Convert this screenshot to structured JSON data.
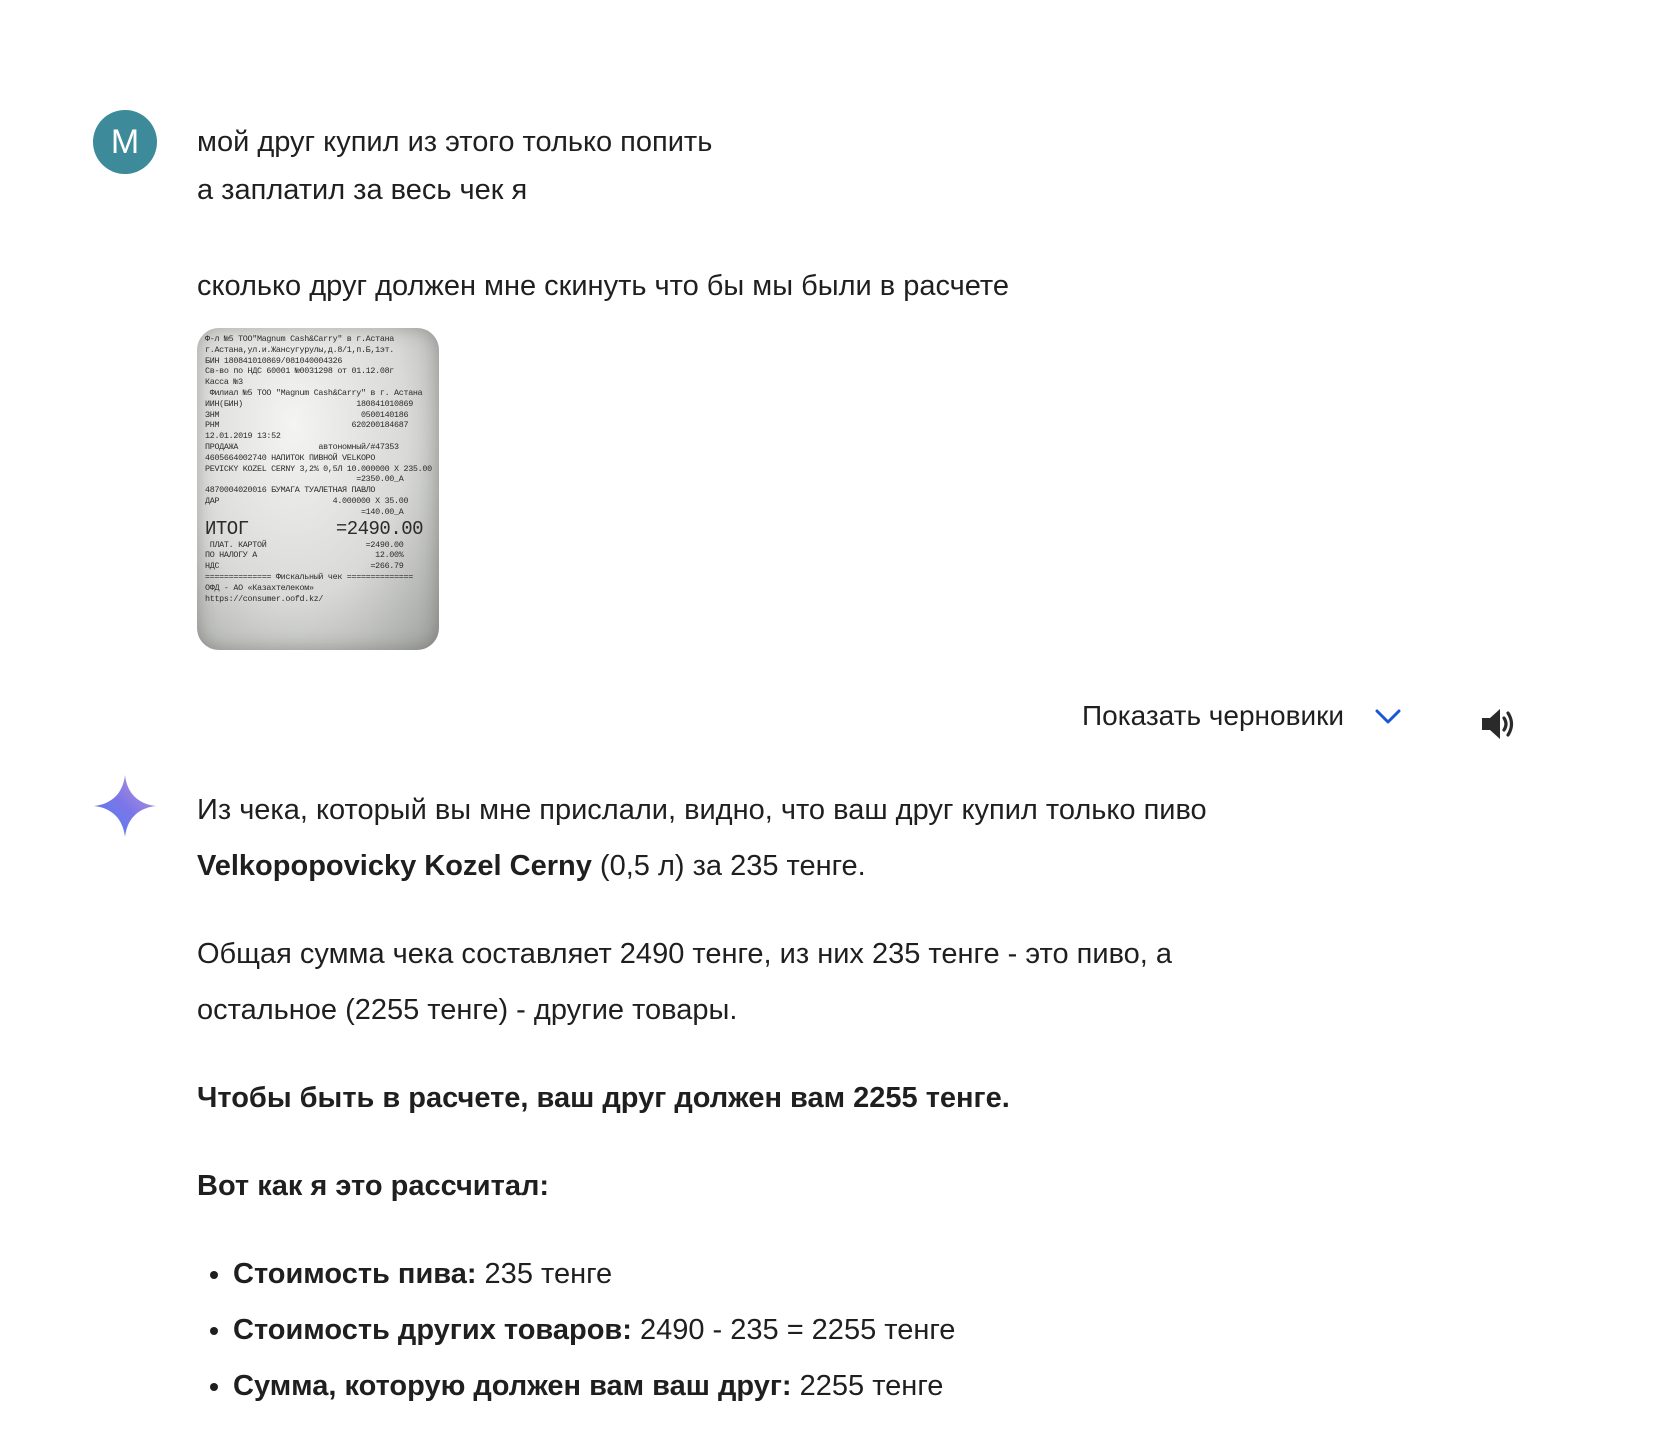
{
  "user": {
    "avatar_letter": "M",
    "lines": [
      "мой друг купил из этого только попить",
      "а заплатил за весь чек я",
      "сколько друг должен мне скинуть что бы мы были в расчете"
    ],
    "receipt_text": "Ф-л №5 ТОО\"Magnum Cash&Carry\" в г.Астана\nг.Астана,ул.и.Жансугурулы,д.8/1,п.Б,1эт.\nБИН 180841010869/081040004326\nСв-во по НДС 60001 №0031298 от 01.12.08г\nКасса №3\n Филиал №5 ТОО \"Magnum Cash&Carry\" в г. Астана\nИИН(БИН)                        180841010869\nЗНМ                              0500140186\nРНМ                            620200184687\n12.01.2019 13:52\nПРОДАЖА                 автономный/#47353\n4605664002740 НАПИТОК ПИВНОЙ VELKOPO\nPEVICKY KOZEL CERNY 3,2% 0,5Л 10.000000 X 235.00\n                                =2350.00_А\n4870004020016 БУМАГА ТУАЛЕТНАЯ ПАВЛО\nДАР                        4.000000 X 35.00\n                                 =140.00_А\n",
    "receipt_total_label": "ИТОГ",
    "receipt_total_value": "=2490.00",
    "receipt_footer": " ПЛАТ. КАРТОЙ                     =2490.00\nПО НАЛОГУ А                         12.00%\nНДС                                =266.79\n============== Фискальный чек ==============\nОФД - АО «Казахтелеком»\nhttps://consumer.oofd.kz/"
  },
  "toolbar": {
    "drafts_label": "Показать черновики",
    "chevron_icon": "chevron-down-icon",
    "speaker_icon": "speaker-icon",
    "accent_color": "#1a57d6"
  },
  "response": {
    "p1_pre": "Из чека, который вы мне прислали, видно, что ваш друг купил только пиво",
    "p1_bold": "Velkopopovicky Kozel Cerny",
    "p1_post": " (0,5 л) за 235 тенге.",
    "p2": "Общая сумма чека составляет 2490 тенге, из них 235 тенге - это пиво, а остальное (2255 тенге) - другие товары.",
    "p3": "Чтобы быть в расчете, ваш друг должен вам 2255 тенге.",
    "p4": "Вот как я это рассчитал:",
    "bullets": [
      {
        "label": "Стоимость пива:",
        "value": " 235 тенге"
      },
      {
        "label": "Стоимость других товаров:",
        "value": " 2490 - 235 = 2255 тенге"
      },
      {
        "label": "Сумма, которую должен вам ваш друг:",
        "value": " 2255 тенге"
      }
    ]
  }
}
